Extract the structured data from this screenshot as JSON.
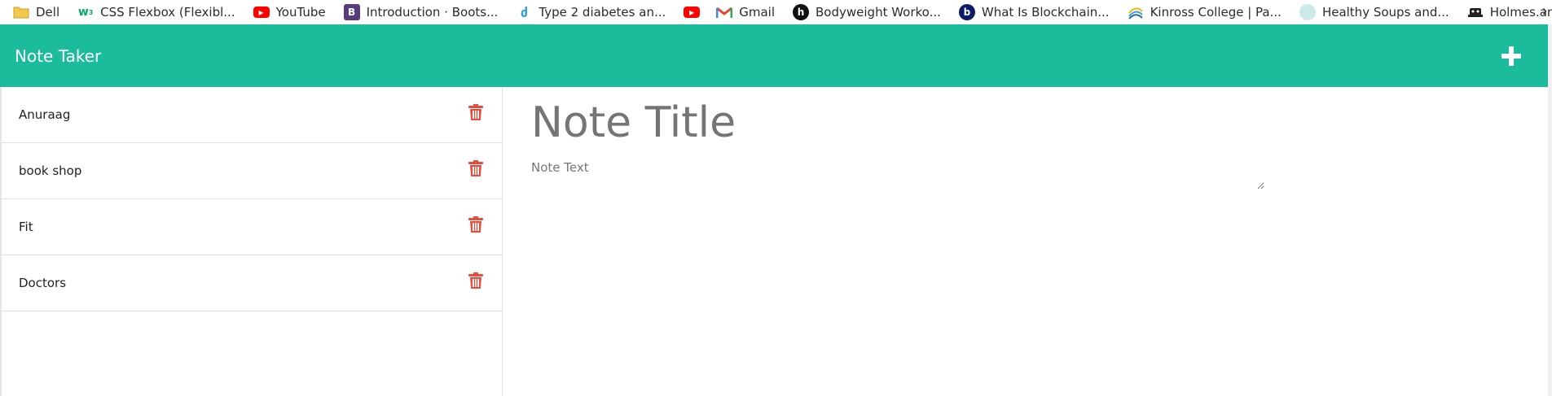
{
  "bookmarks": [
    {
      "label": "Dell",
      "icon": "folder-icon",
      "color": "#f2c94c"
    },
    {
      "label": "CSS Flexbox (Flexibl...",
      "icon": "w3schools-icon",
      "color": "#04aa6d"
    },
    {
      "label": "YouTube",
      "icon": "youtube-icon",
      "color": "#ff0000"
    },
    {
      "label": "Introduction · Boots...",
      "icon": "bootstrap-icon",
      "color": "#563d7c"
    },
    {
      "label": "Type 2 diabetes an...",
      "icon": "diabetes-icon",
      "color": "#2d9cdb"
    },
    {
      "label": "",
      "icon": "youtube-icon",
      "color": "#ff0000"
    },
    {
      "label": "Gmail",
      "icon": "gmail-icon",
      "color": "#ea4335"
    },
    {
      "label": "Bodyweight Worko...",
      "icon": "bodyweight-icon",
      "color": "#111111"
    },
    {
      "label": "What Is Blockchain...",
      "icon": "blockchain-icon",
      "color": "#0b1a6b"
    },
    {
      "label": "Kinross College | Pa...",
      "icon": "kinross-icon",
      "color": "#3aa0d8"
    },
    {
      "label": "Healthy Soups and...",
      "icon": "soups-icon",
      "color": "#9fd3d6"
    },
    {
      "label": "Holmes.and.Watson....",
      "icon": "holmes-icon",
      "color": "#222222"
    }
  ],
  "header": {
    "title": "Note Taker",
    "add_icon": "plus-icon",
    "bg_color": "#1abc9c"
  },
  "notes": [
    {
      "title": "Anuraag"
    },
    {
      "title": "book shop"
    },
    {
      "title": "Fit"
    },
    {
      "title": "Doctors"
    }
  ],
  "delete_icon": "trash-icon",
  "delete_color": "#e74c3c",
  "editor": {
    "title_placeholder": "Note Title",
    "text_placeholder": "Note Text"
  }
}
